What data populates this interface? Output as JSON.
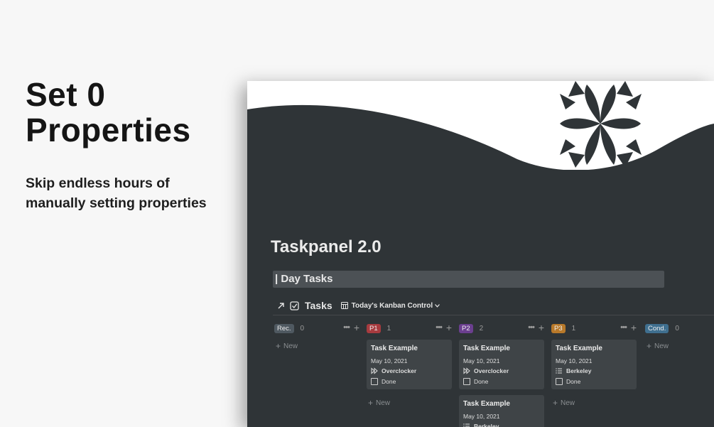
{
  "hero": {
    "title_line1": "Set 0",
    "title_line2": "Properties",
    "subtitle_line1": "Skip endless hours of",
    "subtitle_line2": "manually setting properties"
  },
  "page": {
    "title": "Taskpanel 2.0",
    "section": "| Day Tasks"
  },
  "database": {
    "title": "Tasks",
    "view": "Today's Kanban Control",
    "view_icon": "table-icon",
    "link_icon": "arrow-up-right-icon",
    "db_icon": "checkbox-icon"
  },
  "columns": [
    {
      "tag": "Rec.",
      "emoji_icon": "refresh-icon",
      "count": "0",
      "color": "#4f5961",
      "cards": []
    },
    {
      "tag": "P1",
      "emoji_icon": "pushpin-icon",
      "count": "1",
      "color": "#a73b3f",
      "cards": [
        {
          "title": "Task Example",
          "date": "May 10, 2021",
          "prop": "Overclocker",
          "prop_icon": "fast-forward-icon",
          "done": "Done"
        }
      ]
    },
    {
      "tag": "P2",
      "emoji_icon": "hourglass-icon",
      "count": "2",
      "color": "#6b3f8f",
      "cards": [
        {
          "title": "Task Example",
          "date": "May 10, 2021",
          "prop": "Overclocker",
          "prop_icon": "fast-forward-icon",
          "done": "Done"
        },
        {
          "title": "Task Example",
          "date": "May 10, 2021",
          "prop": "Berkeley",
          "prop_icon": "list-icon",
          "done": ""
        }
      ]
    },
    {
      "tag": "P3",
      "emoji_icon": "sun-icon",
      "count": "1",
      "color": "#b8792a",
      "cards": [
        {
          "title": "Task Example",
          "date": "May 10, 2021",
          "prop": "Berkeley",
          "prop_icon": "list-icon",
          "done": "Done"
        }
      ]
    },
    {
      "tag": "Cond.",
      "emoji_icon": "pause-icon",
      "count": "0",
      "color": "#3f6f8f",
      "cards": []
    }
  ],
  "new_label": "New",
  "colors": {
    "background": "#2f3437",
    "card": "#3f4447",
    "page": "#f7f7f7"
  }
}
